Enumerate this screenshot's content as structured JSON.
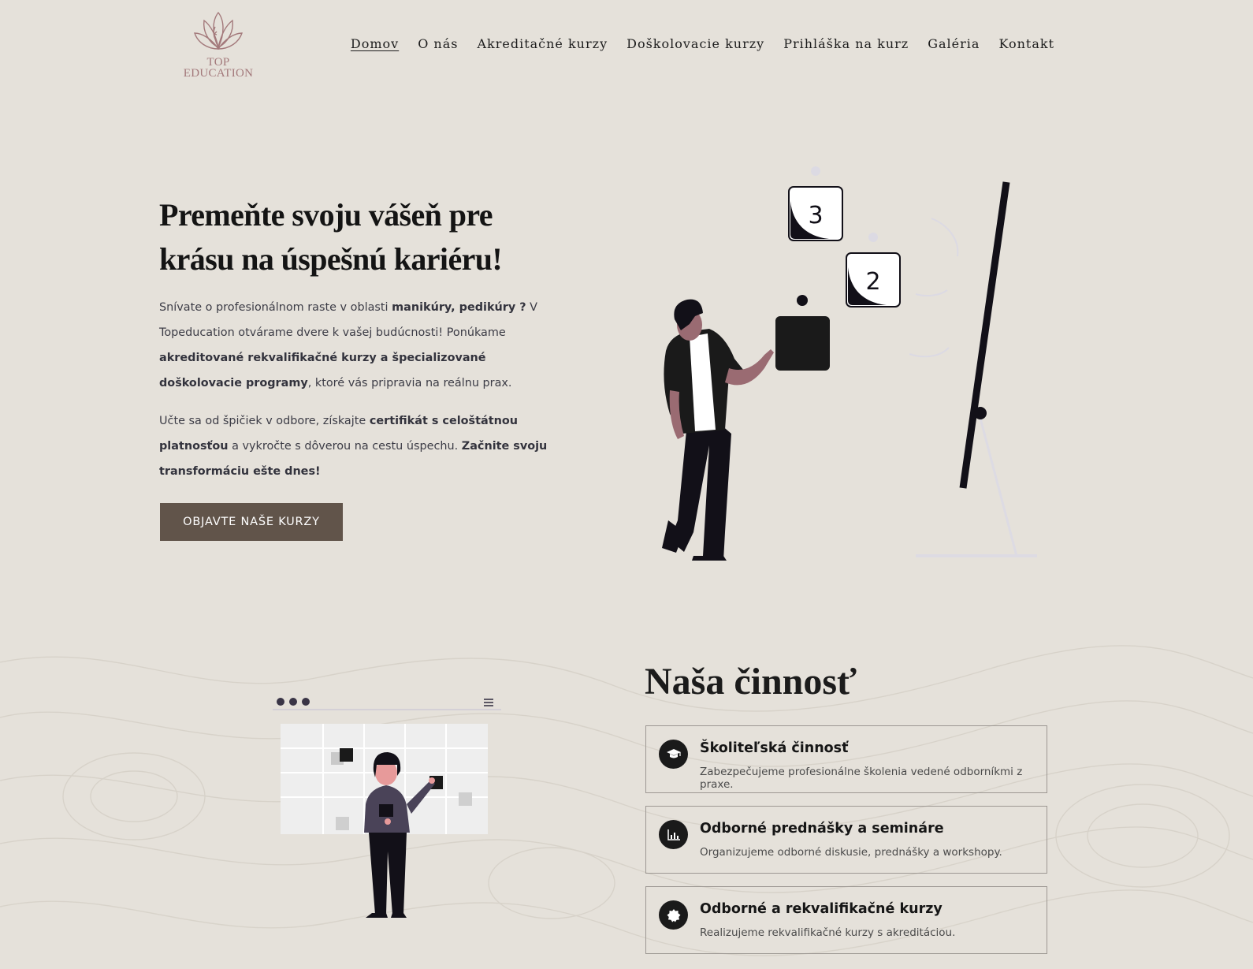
{
  "logo": {
    "line1": "TOP",
    "line2": "EDUCATION",
    "icon": "lotus-face-icon"
  },
  "nav": {
    "items": [
      {
        "label": "Domov",
        "active": true
      },
      {
        "label": "O nás"
      },
      {
        "label": "Akreditačné kurzy"
      },
      {
        "label": "Doškolovacie kurzy"
      },
      {
        "label": "Prihláška na kurz"
      },
      {
        "label": "Galéria"
      },
      {
        "label": "Kontakt"
      }
    ]
  },
  "hero": {
    "title": "Premeňte svoju vášeň pre krásu na úspešnú kariéru!",
    "p1": {
      "t1": "Snívate o profesionálnom raste v oblasti ",
      "b1": "manikúry, pedikúry ?",
      "t2": " V Topeducation otvárame dvere k vašej budúcnosti! Ponúkame ",
      "b2": "akreditované rekvalifikačné kurzy a špecializované doškolovacie pro­gramy",
      "t3": ", ktoré vás pripravia na reálnu prax."
    },
    "p2": {
      "t1": "Učte sa od špičiek v odbore, získajte ",
      "b1": "certifikát s celoštátnou platnosťou",
      "t2": " a vykročte s dôverou na cestu úspechu. ",
      "b2": "Začnite svoju transformáciu ešte dnes!"
    },
    "cta": "OBJAVTE NAŠE KURZY",
    "illustration": {
      "step3": "3",
      "step2": "2"
    }
  },
  "activity": {
    "title": "Naša činnosť",
    "cards": [
      {
        "icon": "graduation-cap-icon",
        "title": "Školiteľská činnosť",
        "desc": "Zabezpečujeme profesionálne školenia vedené odborníkmi z praxe."
      },
      {
        "icon": "chart-icon",
        "title": "Odborné prednášky a semináre",
        "desc": "Organizujeme odborné diskusie, prednášky a workshopy."
      },
      {
        "icon": "badge-icon",
        "title": "Odborné a rekvalifikačné kurzy",
        "desc": "Realizujeme rekvalifikačné kurzy s akreditáciou."
      }
    ]
  },
  "colors": {
    "background": "#e5e1da",
    "button": "#61544a",
    "logo": "#a3797b",
    "text": "#1d1d1d"
  }
}
